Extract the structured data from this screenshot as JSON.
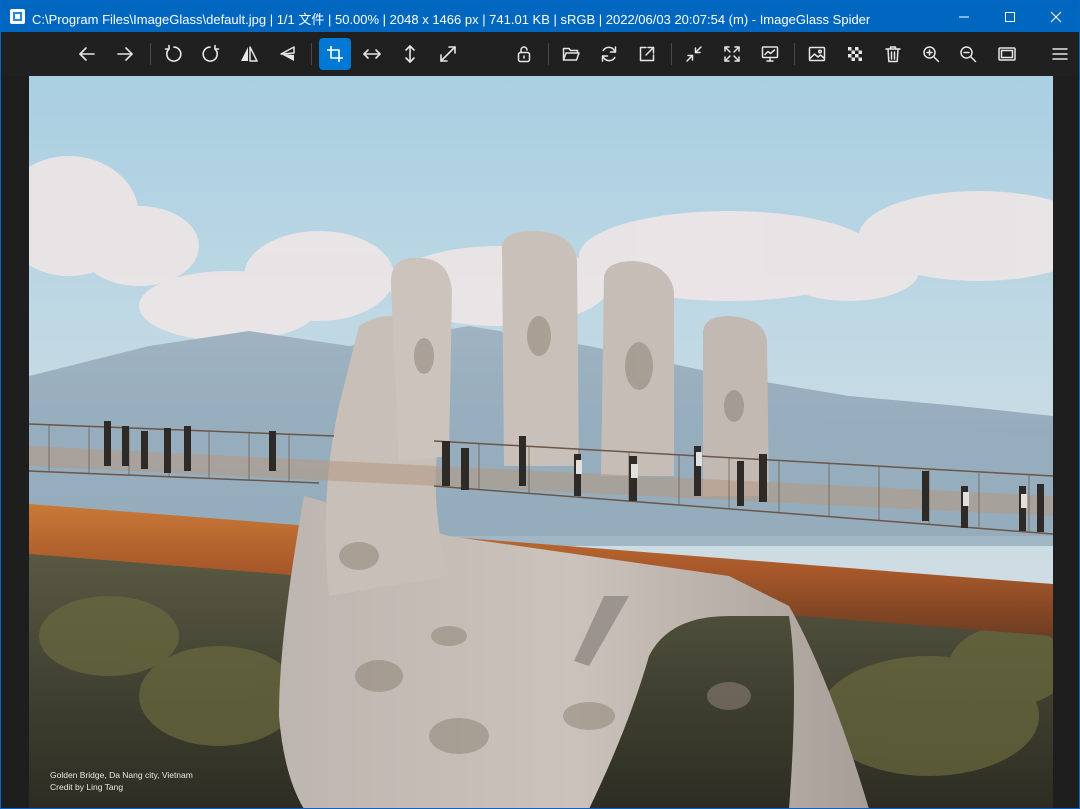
{
  "titlebar": {
    "title": "C:\\Program Files\\ImageGlass\\default.jpg  |  1/1 文件  |  50.00%  |  2048 x 1466 px  |  741.01 KB  |  sRGB  |  2022/06/03 20:07:54 (m)  - ImageGlass Spider",
    "background_color": "#0067c0"
  },
  "toolbar": {
    "active_color": "#0078d4",
    "buttons": [
      {
        "id": "previous",
        "icon": "arrow-left-icon"
      },
      {
        "id": "next",
        "icon": "arrow-right-icon"
      },
      {
        "id": "rotate-left",
        "icon": "rotate-left-icon"
      },
      {
        "id": "rotate-right",
        "icon": "rotate-right-icon"
      },
      {
        "id": "flip-horizontal",
        "icon": "flip-horizontal-icon"
      },
      {
        "id": "flip-vertical",
        "icon": "flip-vertical-icon"
      },
      {
        "id": "auto-zoom",
        "icon": "crop-frame-icon",
        "active": true
      },
      {
        "id": "fit-width",
        "icon": "arrows-horizontal-icon"
      },
      {
        "id": "fit-height",
        "icon": "arrows-vertical-icon"
      },
      {
        "id": "fit-screen",
        "icon": "arrows-diagonal-icon"
      },
      {
        "id": "lock-zoom",
        "icon": "lock-open-icon"
      },
      {
        "id": "open-file",
        "icon": "folder-open-icon"
      },
      {
        "id": "refresh",
        "icon": "refresh-icon"
      },
      {
        "id": "open-with",
        "icon": "external-open-icon"
      },
      {
        "id": "collapse",
        "icon": "shrink-arrows-icon"
      },
      {
        "id": "fullscreen",
        "icon": "expand-arrows-icon"
      },
      {
        "id": "slideshow",
        "icon": "presentation-icon"
      },
      {
        "id": "set-wallpaper",
        "icon": "image-icon"
      },
      {
        "id": "checkerboard",
        "icon": "checkerboard-icon"
      },
      {
        "id": "delete",
        "icon": "trash-icon"
      },
      {
        "id": "zoom-in",
        "icon": "zoom-in-icon"
      },
      {
        "id": "zoom-out",
        "icon": "zoom-out-icon"
      },
      {
        "id": "window-fit",
        "icon": "window-frame-icon"
      },
      {
        "id": "menu",
        "icon": "hamburger-menu-icon"
      }
    ]
  },
  "image": {
    "caption_line1": "Golden Bridge, Da Nang city, Vietnam",
    "caption_line2": "Credit by Ling Tang"
  }
}
